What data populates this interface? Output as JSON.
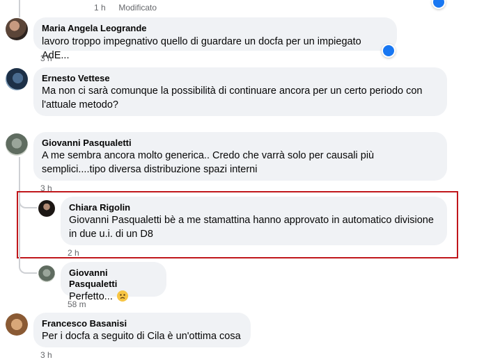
{
  "top": {
    "time": "1 h",
    "edited": "Modificato"
  },
  "comments": [
    {
      "author": "Maria Angela Leogrande",
      "text": "lavoro troppo impegnativo quello di guardare un docfa per un impiegato AdE...",
      "time": "3 h"
    },
    {
      "author": "Ernesto Vettese",
      "text_line1": "Ma non ci sarà comunque la possibilità di continuare ancora per un certo periodo con",
      "text_line2": "l'attuale metodo?"
    },
    {
      "author": "Giovanni Pasqualetti",
      "text_line1": "A me sembra ancora molto generica.. Credo che varrà solo per causali più",
      "text_line2": "semplici....tipo diversa distribuzione spazi interni",
      "time": "3 h"
    },
    {
      "author": "Chiara Rigolin",
      "text_line1": "Giovanni Pasqualetti bè a me stamattina hanno approvato in automatico divisione",
      "text_line2": "in due u.i. di un D8",
      "time": "2 h"
    },
    {
      "author": "Giovanni Pasqualetti",
      "text": "Perfetto...",
      "emoji": "frowning-face-emoji",
      "time": "58 m"
    },
    {
      "author": "Francesco Basanisi",
      "text": "Per i docfa a seguito di Cila è un'ottima cosa",
      "time": "3 h"
    }
  ],
  "colors": {
    "bubble": "#f0f2f5",
    "meta": "#65676b",
    "like": "#1877f2",
    "highlight": "#c0161b"
  }
}
